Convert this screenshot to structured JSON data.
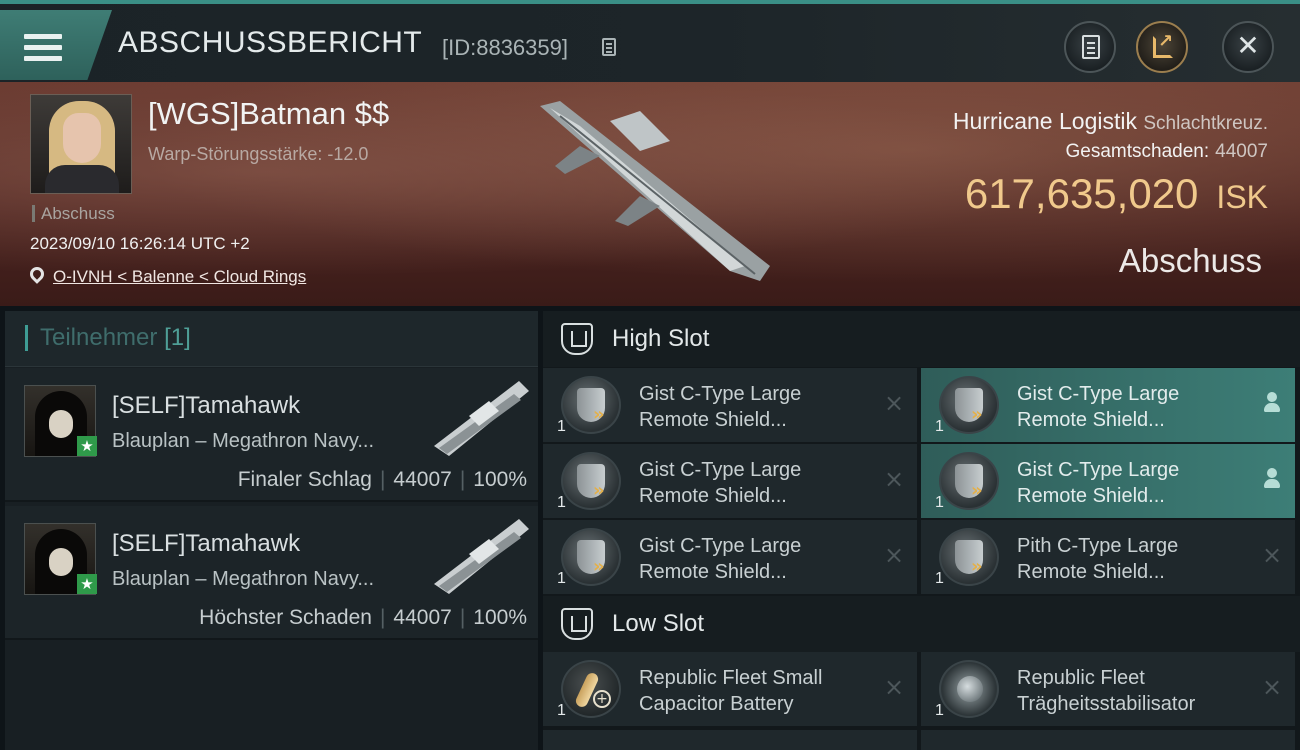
{
  "header": {
    "title": "ABSCHUSSBERICHT",
    "report_id": "[ID:8836359]",
    "icons": [
      "menu-icon",
      "copy-icon",
      "clipboard-icon",
      "share-icon",
      "close-icon"
    ]
  },
  "victim": {
    "name": "[WGS]Batman $$",
    "warp": "Warp-Störungsstärke: -12.0",
    "event_type": "Abschuss",
    "datetime": "2023/09/10 16:26:14 UTC +2",
    "location": "O-IVNH < Balenne < Cloud Rings",
    "ship_name": "Hurricane Logistik",
    "ship_class": "Schlachtkreuz.",
    "damage_label": "Gesamtschaden:",
    "damage_value": "44007",
    "isk_value": "617,635,020",
    "isk_unit": "ISK",
    "result": "Abschuss"
  },
  "participants": {
    "title": "Teilnehmer",
    "count": "[1]",
    "items": [
      {
        "name": "[SELF]Tamahawk",
        "ship": "Blauplan – Megathron Navy...",
        "role": "Finaler Schlag",
        "damage": "44007",
        "percent": "100%"
      },
      {
        "name": "[SELF]Tamahawk",
        "ship": "Blauplan – Megathron Navy...",
        "role": "Höchster Schaden",
        "damage": "44007",
        "percent": "100%"
      }
    ]
  },
  "high_slot": {
    "title": "High Slot",
    "modules": [
      {
        "qty": "1",
        "name_line1": "Gist C-Type Large",
        "name_line2": "Remote Shield...",
        "status": "×",
        "highlighted": false
      },
      {
        "qty": "1",
        "name_line1": "Gist C-Type Large",
        "name_line2": "Remote Shield...",
        "status": "user",
        "highlighted": true
      },
      {
        "qty": "1",
        "name_line1": "Gist C-Type Large",
        "name_line2": "Remote Shield...",
        "status": "×",
        "highlighted": false
      },
      {
        "qty": "1",
        "name_line1": "Gist C-Type Large",
        "name_line2": "Remote Shield...",
        "status": "user",
        "highlighted": true
      },
      {
        "qty": "1",
        "name_line1": "Gist C-Type Large",
        "name_line2": "Remote Shield...",
        "status": "×",
        "highlighted": false
      },
      {
        "qty": "1",
        "name_line1": "Pith C-Type Large",
        "name_line2": "Remote Shield...",
        "status": "×",
        "highlighted": false
      }
    ]
  },
  "low_slot": {
    "title": "Low Slot",
    "modules": [
      {
        "qty": "1",
        "name_line1": "Republic Fleet Small",
        "name_line2": "Capacitor Battery",
        "status": "×",
        "highlighted": false
      },
      {
        "qty": "1",
        "name_line1": "Republic Fleet",
        "name_line2": "Trägheitsstabilisator",
        "status": "×",
        "highlighted": false
      }
    ]
  }
}
